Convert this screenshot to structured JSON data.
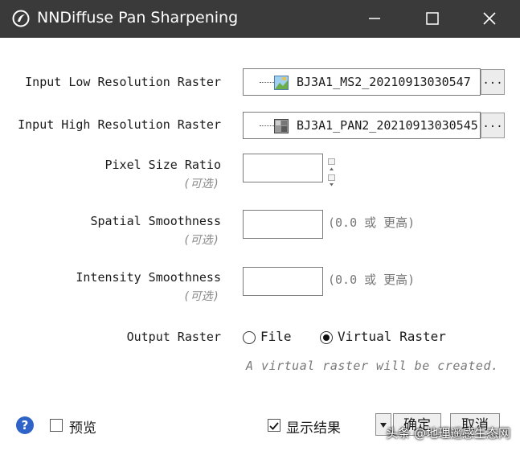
{
  "window": {
    "title": "NNDiffuse Pan Sharpening"
  },
  "fields": {
    "low_res": {
      "label": "Input Low Resolution Raster",
      "value": "BJ3A1_MS2_20210913030547",
      "browse_label": "...",
      "icon": "color-raster-icon"
    },
    "high_res": {
      "label": "Input High Resolution Raster",
      "value": "BJ3A1_PAN2_20210913030545",
      "browse_label": "...",
      "icon": "gray-raster-icon"
    },
    "pixel_size_ratio": {
      "label": "Pixel Size Ratio",
      "optional": "(可选)",
      "value": ""
    },
    "spatial_smoothness": {
      "label": "Spatial Smoothness",
      "optional": "(可选)",
      "value": "",
      "hint": "(0.0 或 更高)"
    },
    "intensity_smoothness": {
      "label": "Intensity Smoothness",
      "optional": "(可选)",
      "value": "",
      "hint": "(0.0 或 更高)"
    },
    "output_raster": {
      "label": "Output Raster",
      "options": [
        "File",
        "Virtual Raster"
      ],
      "selected": "Virtual Raster",
      "note": "A virtual raster will be created."
    }
  },
  "footer": {
    "help": "?",
    "preview_label": "预览",
    "preview_checked": false,
    "display_result_label": "显示结果",
    "display_result_checked": true,
    "ok_label": "确定",
    "cancel_label": "取消"
  },
  "watermark": "头条 @地理遥感生态网"
}
